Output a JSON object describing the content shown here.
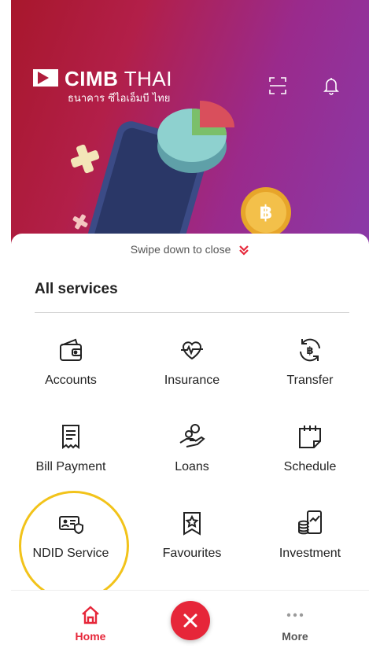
{
  "header": {
    "brand_main": "CIMB",
    "brand_suffix": "THAI",
    "brand_thai": "ธนาคาร ซีไอเอ็มบี ไทย",
    "icons": [
      "scan-icon",
      "bell-icon"
    ]
  },
  "sheet": {
    "swipe_hint": "Swipe down to close",
    "title": "All services",
    "services": [
      {
        "label": "Accounts",
        "icon": "wallet-icon"
      },
      {
        "label": "Insurance",
        "icon": "heart-pulse-icon"
      },
      {
        "label": "Transfer",
        "icon": "baht-refresh-icon"
      },
      {
        "label": "Bill Payment",
        "icon": "receipt-icon"
      },
      {
        "label": "Loans",
        "icon": "hand-coin-icon"
      },
      {
        "label": "Schedule",
        "icon": "calendar-icon"
      },
      {
        "label": "NDID Service",
        "icon": "id-card-shield-icon"
      },
      {
        "label": "Favourites",
        "icon": "bookmark-star-icon"
      },
      {
        "label": "Investment",
        "icon": "coin-chart-icon"
      }
    ]
  },
  "nav": {
    "home_label": "Home",
    "more_label": "More"
  },
  "colors": {
    "accent": "#e62639",
    "highlight": "#f2c31a"
  }
}
